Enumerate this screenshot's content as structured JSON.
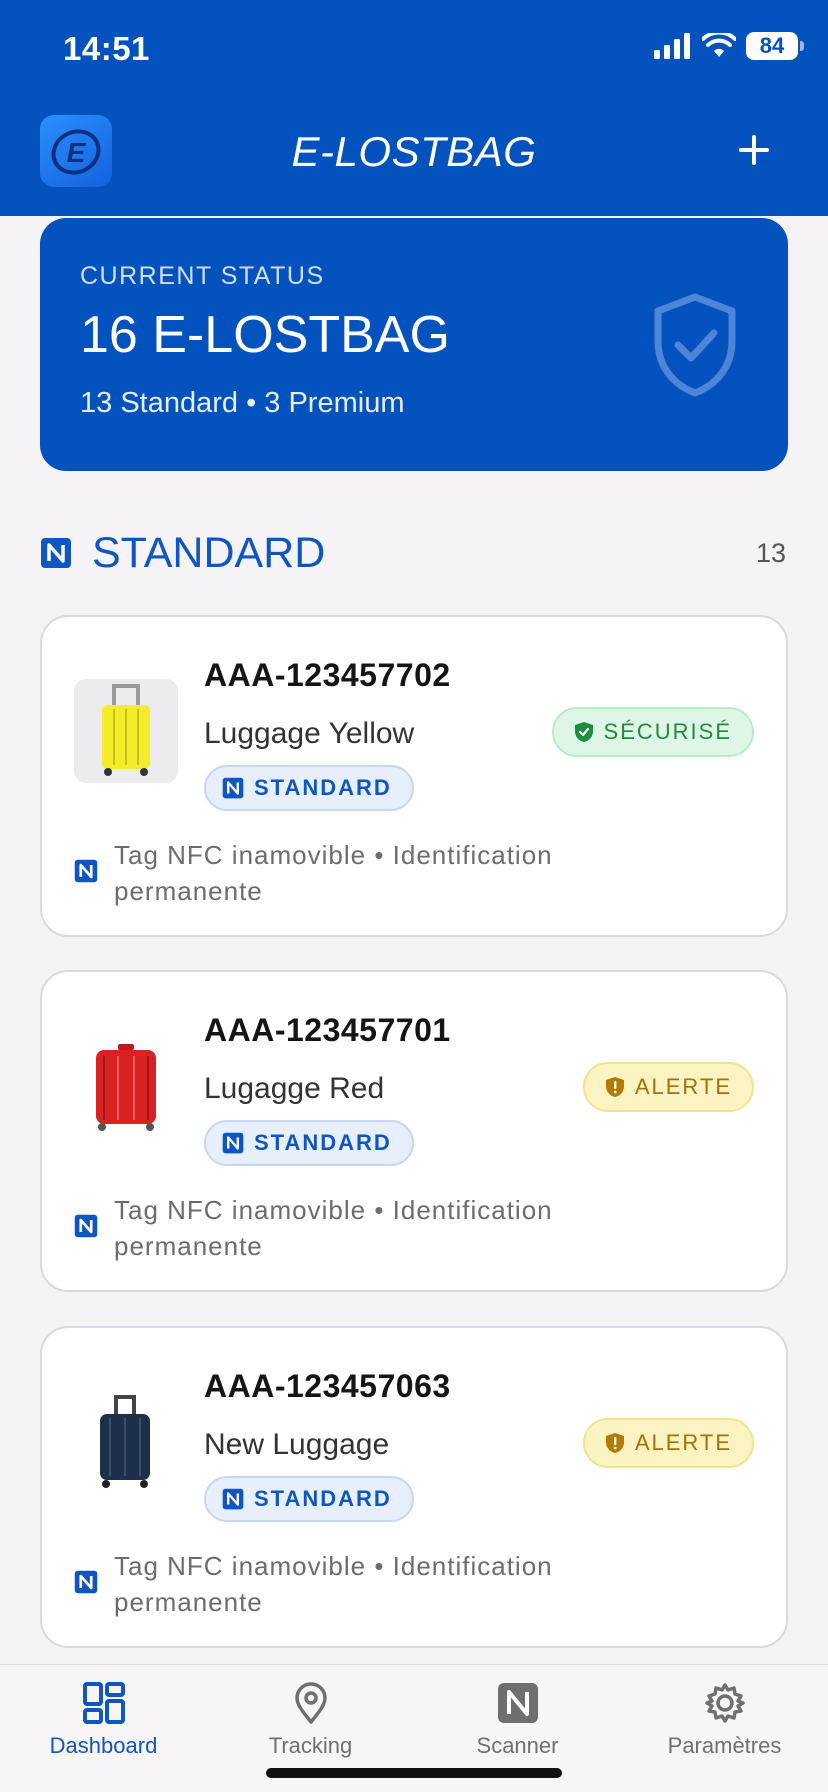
{
  "status_bar": {
    "time": "14:51",
    "battery": "84"
  },
  "header": {
    "title": "E-LOSTBAG",
    "add_label": "+"
  },
  "status_card": {
    "label": "CURRENT STATUS",
    "count": "16 E-LOSTBAG",
    "breakdown": "13 Standard • 3 Premium"
  },
  "section": {
    "title": "STANDARD",
    "count": "13"
  },
  "bags": [
    {
      "id": "AAA-123457702",
      "name": "Luggage Yellow",
      "tier": "STANDARD",
      "state": "SÉCURISÉ",
      "note": "Tag NFC inamovible • Identification permanente"
    },
    {
      "id": "AAA-123457701",
      "name": "Lugagge Red",
      "tier": "STANDARD",
      "state": "ALERTE",
      "note": "Tag NFC inamovible • Identification permanente"
    },
    {
      "id": "AAA-123457063",
      "name": "New Luggage",
      "tier": "STANDARD",
      "state": "ALERTE",
      "note": "Tag NFC inamovible • Identification permanente"
    }
  ],
  "nav": {
    "dashboard": "Dashboard",
    "tracking": "Tracking",
    "scanner": "Scanner",
    "settings": "Paramètres"
  },
  "colors": {
    "brand_blue": "#0352bd",
    "ok_green": "#1c8c3e",
    "alert_amber": "#a67100"
  }
}
